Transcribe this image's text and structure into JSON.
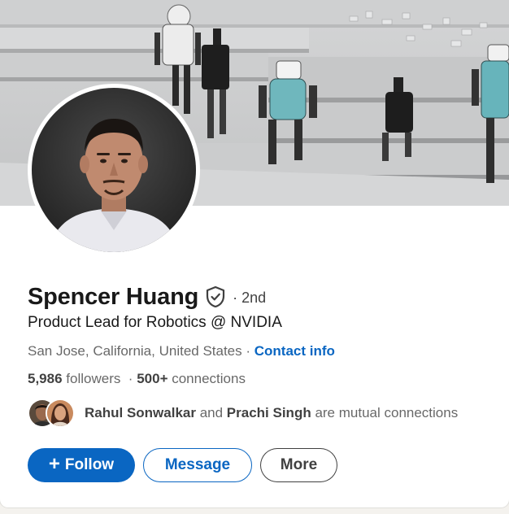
{
  "profile": {
    "name": "Spencer Huang",
    "degree": "· 2nd",
    "headline": "Product Lead for Robotics @ NVIDIA",
    "location": "San Jose, California, United States",
    "location_separator": " · ",
    "contact_info": "Contact info",
    "followers_count": "5,986",
    "followers_label": " followers",
    "stats_separator": "  · ",
    "connections_count": "500+",
    "connections_label": " connections",
    "mutual": {
      "person1": "Rahul Sonwalkar",
      "joiner": " and ",
      "person2": "Prachi Singh",
      "suffix": " are mutual connections"
    }
  },
  "actions": {
    "follow_icon": "+",
    "follow_label": "Follow",
    "message_label": "Message",
    "more_label": "More"
  },
  "icons": {
    "verified": "shield-check-icon"
  },
  "colors": {
    "brand_blue": "#0a66c2",
    "card_bg": "#ffffff",
    "page_bg": "#f4f2ee"
  }
}
